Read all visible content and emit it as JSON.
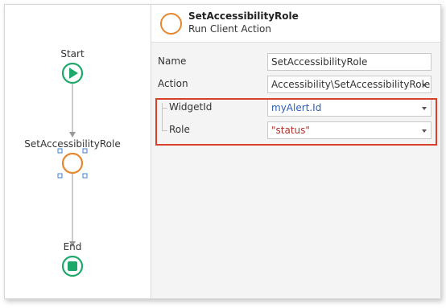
{
  "flow": {
    "start_label": "Start",
    "action_label": "SetAccessibilityRole",
    "end_label": "End",
    "start_color": "#1ea86a",
    "action_color": "#e6862e",
    "selection_color": "#3b7fd4"
  },
  "panel": {
    "title": "SetAccessibilityRole",
    "subtitle": "Run Client Action",
    "properties": {
      "name": {
        "label": "Name",
        "value": "SetAccessibilityRole"
      },
      "action": {
        "label": "Action",
        "value": "Accessibility\\SetAccessibilityRole"
      },
      "widget_id": {
        "label": "WidgetId",
        "value": "myAlert.Id",
        "value_color": "#2b5fb8"
      },
      "role": {
        "label": "Role",
        "value": "\"status\"",
        "value_color": "#b3302a"
      }
    },
    "highlight_color": "#d9402b"
  }
}
